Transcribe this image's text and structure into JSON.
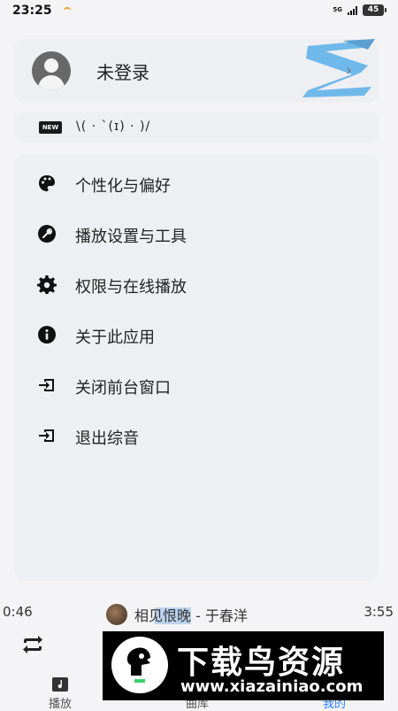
{
  "status_bar": {
    "time": "23:25",
    "network": "5G",
    "battery": "45"
  },
  "profile": {
    "login_label": "未登录",
    "logo_color": "#6fb8ea"
  },
  "motd": {
    "badge": "NEW",
    "text": "\\( · `(ɪ) · )/"
  },
  "menu": {
    "items": [
      {
        "label": "个性化与偏好",
        "icon": "palette-icon"
      },
      {
        "label": "播放设置与工具",
        "icon": "wrench-icon"
      },
      {
        "label": "权限与在线播放",
        "icon": "gear-icon"
      },
      {
        "label": "关于此应用",
        "icon": "info-icon"
      },
      {
        "label": "关闭前台窗口",
        "icon": "exit-icon"
      },
      {
        "label": "退出综音",
        "icon": "exit-icon"
      }
    ]
  },
  "player": {
    "elapsed": "0:46",
    "duration": "3:55",
    "song": "相见恨晚",
    "separator": " - ",
    "artist": "于春洋"
  },
  "nav": {
    "tabs": [
      {
        "label": "播放",
        "icon": "music-note-icon"
      },
      {
        "label": "曲库",
        "icon": "library-icon"
      },
      {
        "label": "我的",
        "icon": "person-icon",
        "active": true
      }
    ],
    "active_color": "#2a7cff"
  },
  "watermark": {
    "title": "下载鸟资源",
    "url": "www.xiazainiao.com"
  }
}
